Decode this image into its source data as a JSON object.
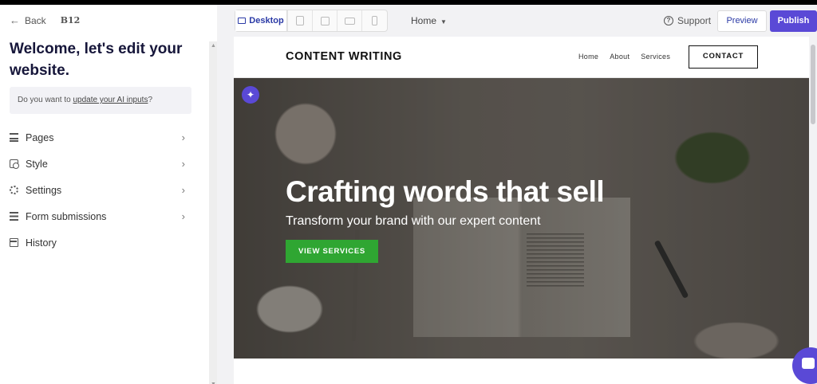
{
  "editor": {
    "back_label": "Back",
    "brand": "B12",
    "welcome_title": "Welcome, let's edit your website.",
    "ai_prompt_prefix": "Do you want to ",
    "ai_prompt_link": "update your AI inputs",
    "ai_prompt_suffix": "?",
    "menu": [
      {
        "label": "Pages",
        "icon": "pages-icon",
        "has_chevron": true
      },
      {
        "label": "Style",
        "icon": "style-icon",
        "has_chevron": true
      },
      {
        "label": "Settings",
        "icon": "gear-icon",
        "has_chevron": true
      },
      {
        "label": "Form submissions",
        "icon": "list-icon",
        "has_chevron": true
      },
      {
        "label": "History",
        "icon": "history-icon",
        "has_chevron": false
      }
    ]
  },
  "toolbar": {
    "device_active": "Desktop",
    "page_selector": "Home",
    "support_label": "Support",
    "preview_label": "Preview",
    "publish_label": "Publish",
    "accent_color": "#5a49d6"
  },
  "site": {
    "logo": "CONTENT WRITING",
    "nav": [
      "Home",
      "About",
      "Services"
    ],
    "contact_label": "CONTACT",
    "hero_title": "Crafting words that sell",
    "hero_subtitle": "Transform your brand with our expert content",
    "hero_cta": "VIEW SERVICES",
    "cta_color": "#2fa632"
  }
}
